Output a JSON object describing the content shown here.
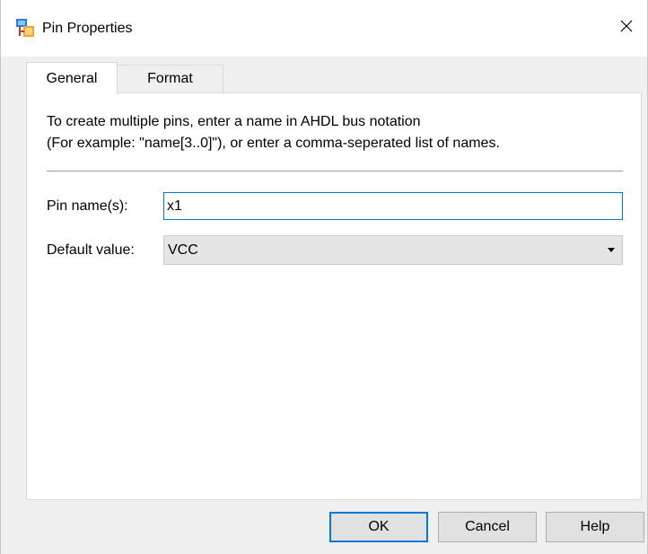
{
  "window": {
    "title": "Pin Properties",
    "title_icon": "pin-properties-app-icon",
    "close_icon": "close-icon"
  },
  "tabs": [
    {
      "label": "General",
      "active": true
    },
    {
      "label": "Format",
      "active": false
    }
  ],
  "general": {
    "description_line1": "To create multiple pins, enter a name in AHDL bus notation",
    "description_line2": "(For example: \"name[3..0]\"), or enter a comma-seperated list of names.",
    "pin_name_label": "Pin name(s):",
    "pin_name_value": "x1",
    "default_value_label": "Default value:",
    "default_value_selected": "VCC"
  },
  "buttons": {
    "ok": "OK",
    "cancel": "Cancel",
    "help": "Help"
  },
  "colors": {
    "accent": "#0078d7",
    "window_bg": "#f0f0f0",
    "panel_bg": "#ffffff",
    "button_bg": "#e1e1e1"
  }
}
